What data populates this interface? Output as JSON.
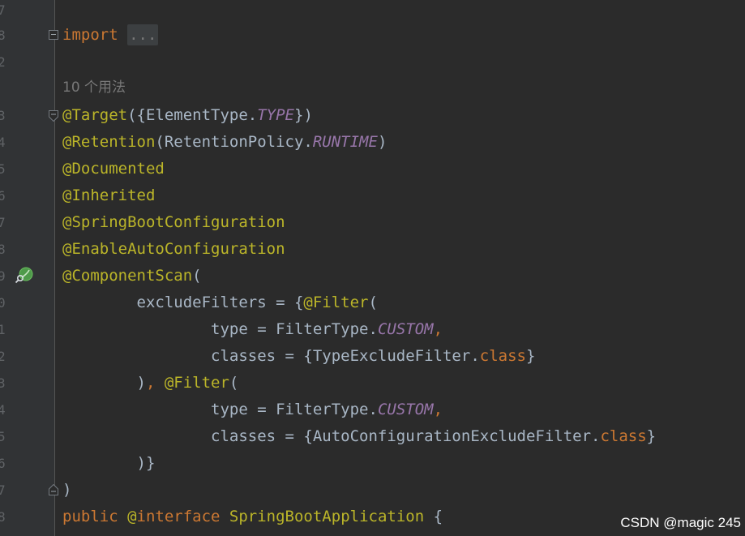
{
  "gutter": {
    "line_numbers": [
      "7",
      "8",
      "2",
      "",
      "3",
      "4",
      "5",
      "6",
      "7",
      "8",
      "9",
      "0",
      "1",
      "2",
      "3",
      "4",
      "5",
      "6",
      "7",
      "8"
    ]
  },
  "code": {
    "import_kw": "import",
    "import_folded": "...",
    "usage_hint": "10 个用法",
    "line3": {
      "ann": "@Target",
      "t1": "({ElementType.",
      "const": "TYPE",
      "t2": "})"
    },
    "line4": {
      "ann": "@Retention",
      "t1": "(RetentionPolicy.",
      "const": "RUNTIME",
      "t2": ")"
    },
    "line5": {
      "ann": "@Documented"
    },
    "line6": {
      "ann": "@Inherited"
    },
    "line7": {
      "ann": "@SpringBootConfiguration"
    },
    "line8": {
      "ann": "@EnableAutoConfiguration"
    },
    "line9": {
      "ann": "@ComponentScan",
      "t1": "("
    },
    "line10": {
      "t1": "        excludeFilters = {",
      "ann": "@Filter",
      "t2": "("
    },
    "line11": {
      "t1": "                type = FilterType.",
      "const": "CUSTOM",
      "kw": ","
    },
    "line12": {
      "t1": "                classes = {TypeExcludeFilter.",
      "kw": "class",
      "t2": "}"
    },
    "line13": {
      "t1": "        )",
      "kw": ", ",
      "ann": "@Filter",
      "t2": "("
    },
    "line14": {
      "t1": "                type = FilterType.",
      "const": "CUSTOM",
      "kw": ","
    },
    "line15": {
      "t1": "                classes = {AutoConfigurationExcludeFilter.",
      "kw": "class",
      "t2": "}"
    },
    "line16": {
      "t1": "        )}"
    },
    "line17": {
      "t1": ")"
    },
    "line18": {
      "kw1": "public ",
      "ann": "@",
      "kw2": "interface ",
      "name": "SpringBootApplication",
      "t1": " {"
    }
  },
  "colors": {
    "background": "#2b2b2b",
    "gutter": "#313335",
    "keyword": "#cc7832",
    "annotation": "#bbb529",
    "constant": "#9876aa",
    "text": "#a9b7c6",
    "line_number": "#606366"
  },
  "icons": {
    "fold_marker": "fold-icon",
    "spring_bean": "spring-bean-icon"
  },
  "watermark": "CSDN @magic 245"
}
